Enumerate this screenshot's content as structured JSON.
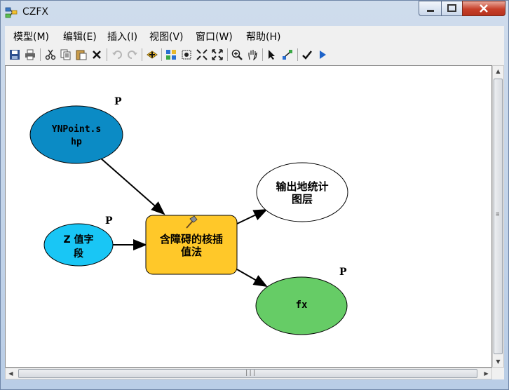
{
  "window": {
    "title": "CZFX"
  },
  "menu": [
    "模型(M)",
    "编辑(E)",
    "插入(I)",
    "视图(V)",
    "窗口(W)",
    "帮助(H)"
  ],
  "toolbar": {
    "icons": [
      "save-icon",
      "print-icon",
      "cut-icon",
      "copy-icon",
      "paste-icon",
      "delete-icon",
      "undo-icon",
      "redo-icon",
      "add-data-icon",
      "auto-layout-icon",
      "select-all-icon",
      "zoom-fixed-in-icon",
      "full-extent-icon",
      "zoom-in-icon",
      "pan-icon",
      "select-pointer-icon",
      "connect-icon",
      "validate-icon",
      "run-icon"
    ]
  },
  "model": {
    "input_feature": {
      "line1": "YNPoint.s",
      "line2": "hp",
      "param": "P",
      "color": "#0b8bc5"
    },
    "z_field": {
      "line1": "Z 值字",
      "line2": "段",
      "param": "P",
      "color": "#19c6f5"
    },
    "tool": {
      "line1": "含障碍的核插",
      "line2": "值法",
      "color": "#ffc829"
    },
    "output_layer": {
      "line1": "输出地统计",
      "line2": "图层"
    },
    "output_fx": {
      "line1": "fx",
      "param": "P",
      "color": "#66cc66"
    }
  }
}
